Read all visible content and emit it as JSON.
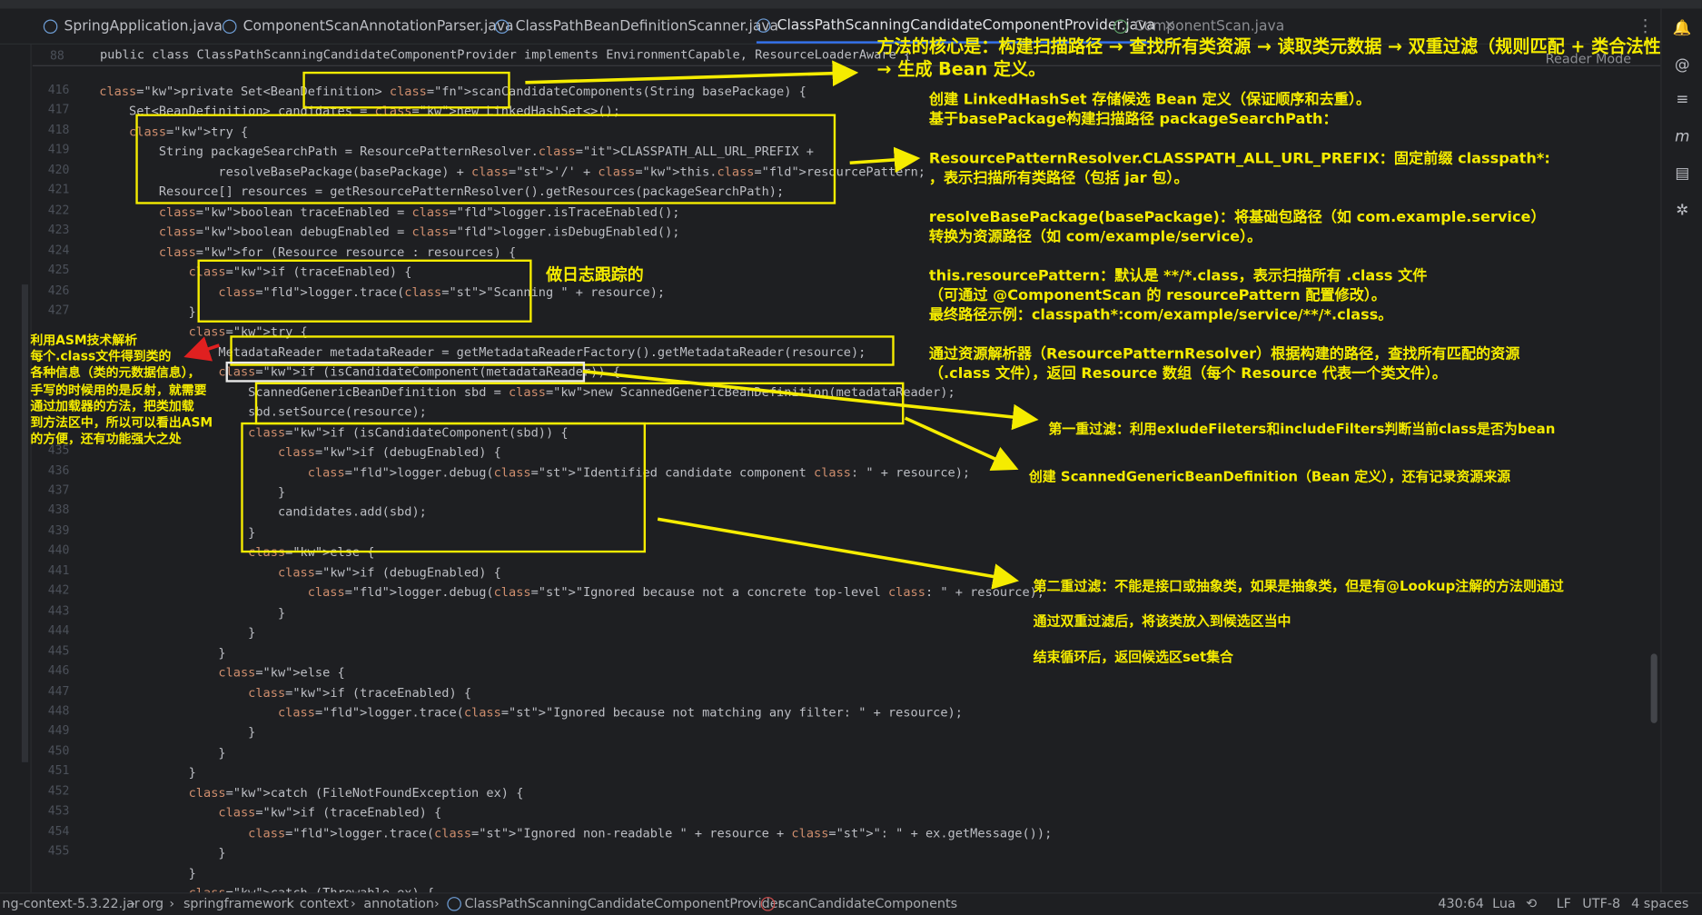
{
  "tabs": [
    {
      "label": "SpringApplication.java",
      "state": "normal"
    },
    {
      "label": "ComponentScanAnnotationParser.java",
      "state": "normal"
    },
    {
      "label": "ClassPathBeanDefinitionScanner.java",
      "state": "normal"
    },
    {
      "label": "ClassPathScanningCandidateComponentProvider.java",
      "state": "active"
    },
    {
      "label": "ComponentScan.java",
      "state": "dim"
    }
  ],
  "reader_mode": "Reader Mode",
  "sticky": {
    "line_number": "88",
    "text": "public class ClassPathScanningCandidateComponentProvider implements EnvironmentCapable, ResourceLoaderAware {"
  },
  "code_lines": [
    {
      "n": "416",
      "t": "    private Set<BeanDefinition> scanCandidateComponents(String basePackage) {"
    },
    {
      "n": "417",
      "t": "        Set<BeanDefinition> candidates = new LinkedHashSet<>();"
    },
    {
      "n": "418",
      "t": "        try {"
    },
    {
      "n": "419",
      "t": "            String packageSearchPath = ResourcePatternResolver.CLASSPATH_ALL_URL_PREFIX +"
    },
    {
      "n": "420",
      "t": "                    resolveBasePackage(basePackage) + '/' + this.resourcePattern;"
    },
    {
      "n": "421",
      "t": "            Resource[] resources = getResourcePatternResolver().getResources(packageSearchPath);"
    },
    {
      "n": "422",
      "t": "            boolean traceEnabled = logger.isTraceEnabled();"
    },
    {
      "n": "423",
      "t": "            boolean debugEnabled = logger.isDebugEnabled();"
    },
    {
      "n": "424",
      "t": "            for (Resource resource : resources) {"
    },
    {
      "n": "425",
      "t": "                if (traceEnabled) {"
    },
    {
      "n": "426",
      "t": "                    logger.trace(\"Scanning \" + resource);"
    },
    {
      "n": "427",
      "t": "                }"
    },
    {
      "n": "",
      "t": "                try {"
    },
    {
      "n": "",
      "t": "                    MetadataReader metadataReader = getMetadataReaderFactory().getMetadataReader(resource);"
    },
    {
      "n": "",
      "t": "                    if (isCandidateComponent(metadataReader)) {"
    },
    {
      "n": "",
      "t": "                        ScannedGenericBeanDefinition sbd = new ScannedGenericBeanDefinition(metadataReader);"
    },
    {
      "n": "",
      "t": "                        sbd.setSource(resource);"
    },
    {
      "n": "",
      "t": "                        if (isCandidateComponent(sbd)) {"
    },
    {
      "n": "435",
      "t": "                            if (debugEnabled) {"
    },
    {
      "n": "436",
      "t": "                                logger.debug(\"Identified candidate component class: \" + resource);"
    },
    {
      "n": "437",
      "t": "                            }"
    },
    {
      "n": "438",
      "t": "                            candidates.add(sbd);"
    },
    {
      "n": "439",
      "t": "                        }"
    },
    {
      "n": "440",
      "t": "                        else {"
    },
    {
      "n": "441",
      "t": "                            if (debugEnabled) {"
    },
    {
      "n": "442",
      "t": "                                logger.debug(\"Ignored because not a concrete top-level class: \" + resource);"
    },
    {
      "n": "443",
      "t": "                            }"
    },
    {
      "n": "444",
      "t": "                        }"
    },
    {
      "n": "445",
      "t": "                    }"
    },
    {
      "n": "446",
      "t": "                    else {"
    },
    {
      "n": "447",
      "t": "                        if (traceEnabled) {"
    },
    {
      "n": "448",
      "t": "                            logger.trace(\"Ignored because not matching any filter: \" + resource);"
    },
    {
      "n": "449",
      "t": "                        }"
    },
    {
      "n": "450",
      "t": "                    }"
    },
    {
      "n": "451",
      "t": "                }"
    },
    {
      "n": "452",
      "t": "                catch (FileNotFoundException ex) {"
    },
    {
      "n": "453",
      "t": "                    if (traceEnabled) {"
    },
    {
      "n": "454",
      "t": "                        logger.trace(\"Ignored non-readable \" + resource + \": \" + ex.getMessage());"
    },
    {
      "n": "455",
      "t": "                    }"
    },
    {
      "n": "",
      "t": "                }"
    },
    {
      "n": "",
      "t": "                catch (Throwable ex) {"
    }
  ],
  "annotations": {
    "core_title_1": "方法的核心是：构建扫描路径 → 查找所有类资源 → 读取类元数据 → 双重过滤（规则匹配 + 类合法性）",
    "core_title_2": "→ 生成 Bean 定义。",
    "right_p1": "创建 LinkedHashSet 存储候选 Bean 定义（保证顺序和去重）。",
    "right_p2": "基于basePackage构建扫描路径 packageSearchPath：",
    "right_p3a": "ResourcePatternResolver.CLASSPATH_ALL_URL_PREFIX：固定前缀 classpath*:",
    "right_p3b": "，表示扫描所有类路径（包括 jar 包）。",
    "right_p4a": "resolveBasePackage(basePackage)：将基础包路径（如 com.example.service）",
    "right_p4b": "转换为资源路径（如 com/example/service）。",
    "right_p5a": "this.resourcePattern：默认是 **/*.class，表示扫描所有 .class 文件",
    "right_p5b": "（可通过 @ComponentScan 的 resourcePattern 配置修改）。",
    "right_p5c": "最终路径示例：classpath*:com/example/service/**/*.class。",
    "right_p6a": "通过资源解析器（ResourcePatternResolver）根据构建的路径，查找所有匹配的资源",
    "right_p6b": "（.class 文件），返回 Resource 数组（每个 Resource 代表一个类文件）。",
    "log_note": "做日志跟踪的",
    "filter1": "第一重过滤：利用exludeFileters和includeFilters判断当前class是否为bean",
    "bean_def": "创建 ScannedGenericBeanDefinition（Bean 定义），还有记录资源来源",
    "filter2": "第二重过滤：不能是接口或抽象类，如果是抽象类，但是有@Lookup注解的方法则通过",
    "after_filter": "通过双重过滤后，将该类放入到候选区当中",
    "end_loop": "结束循环后，返回候选区set集合",
    "asm_note": [
      "利用ASM技术解析",
      "每个.class文件得到类的",
      "各种信息（类的元数据信息），",
      "手写的时候用的是反射，就需要",
      "通过加载器的方法，把类加载",
      "到方法区中，所以可以看出ASM",
      "的方便，还有功能强大之处"
    ]
  },
  "statusbar": {
    "breadcrumbs": [
      "ng-context-5.3.22.jar",
      "org",
      "springframework",
      "context",
      "annotation",
      "ClassPathScanningCandidateComponentProvider",
      "scanCandidateComponents"
    ],
    "position": "430:64",
    "language": "Lua",
    "line_sep": "LF",
    "encoding": "UTF-8",
    "indent": "4 spaces"
  },
  "colors": {
    "annotation": "#f5ec00",
    "arrow_red": "#e02020",
    "keyword": "#cf8e6d",
    "method": "#56a8f5",
    "string": "#6aab73"
  }
}
